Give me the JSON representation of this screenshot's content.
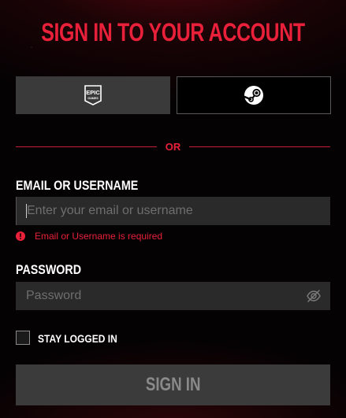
{
  "header": {
    "title": "SIGN IN TO YOUR ACCOUNT"
  },
  "providers": {
    "epic": {
      "icon": "epic-games-logo-icon",
      "logo_text_top": "EPIC",
      "logo_text_bottom": "GAMES"
    },
    "steam": {
      "icon": "steam-logo-icon"
    }
  },
  "divider": {
    "text": "OR"
  },
  "email": {
    "label": "EMAIL OR USERNAME",
    "value": "",
    "placeholder": "Enter your email or username",
    "error": "Email or Username is required",
    "error_icon": "alert-circle-icon"
  },
  "password": {
    "label": "PASSWORD",
    "value": "",
    "placeholder": "Password",
    "toggle_icon": "eye-slash-icon"
  },
  "remember": {
    "label": "STAY LOGGED IN",
    "checked": false
  },
  "submit": {
    "label": "SIGN IN"
  },
  "colors": {
    "accent": "#e8203a",
    "button_bg": "#3a3a3a",
    "input_bg": "#2a2a2a",
    "disabled_text": "#8a8a8a"
  }
}
